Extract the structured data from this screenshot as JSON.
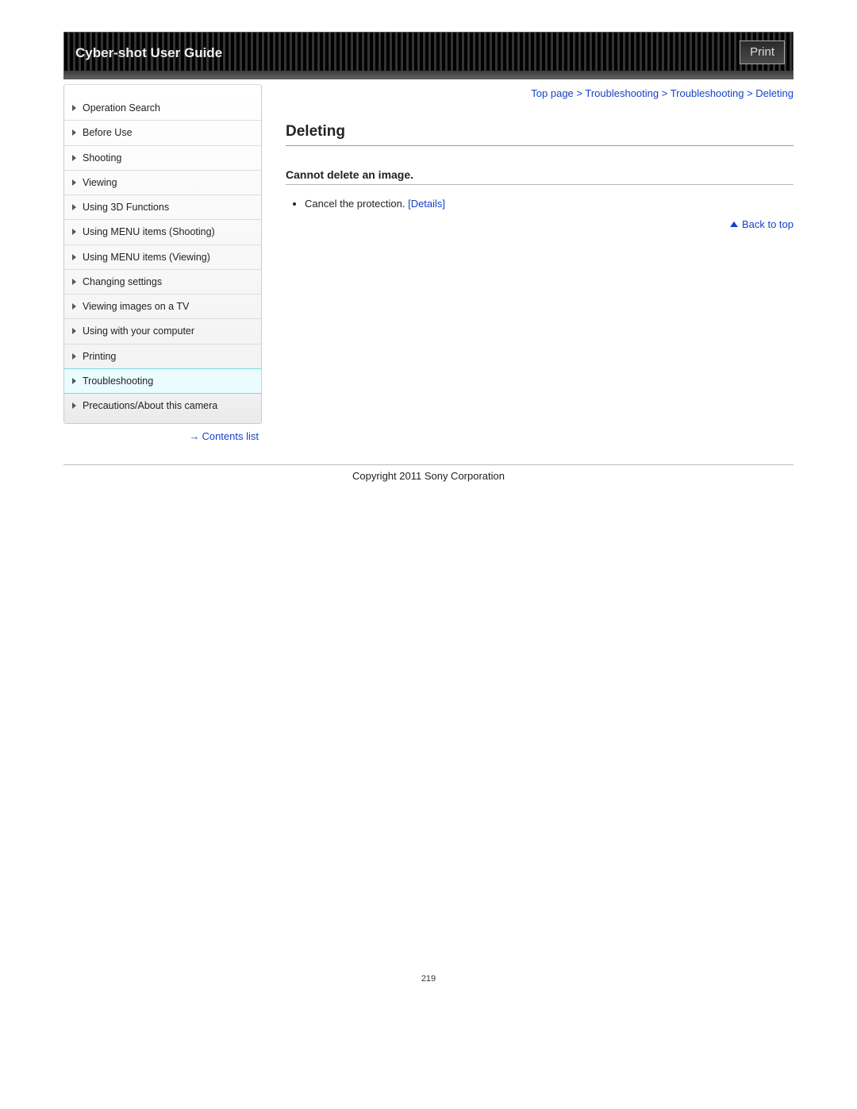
{
  "header": {
    "title": "Cyber-shot User Guide",
    "print_label": "Print"
  },
  "sidebar": {
    "items": [
      {
        "label": "Operation Search",
        "active": false
      },
      {
        "label": "Before Use",
        "active": false
      },
      {
        "label": "Shooting",
        "active": false
      },
      {
        "label": "Viewing",
        "active": false
      },
      {
        "label": "Using 3D Functions",
        "active": false
      },
      {
        "label": "Using MENU items (Shooting)",
        "active": false
      },
      {
        "label": "Using MENU items (Viewing)",
        "active": false
      },
      {
        "label": "Changing settings",
        "active": false
      },
      {
        "label": "Viewing images on a TV",
        "active": false
      },
      {
        "label": "Using with your computer",
        "active": false
      },
      {
        "label": "Printing",
        "active": false
      },
      {
        "label": "Troubleshooting",
        "active": true
      },
      {
        "label": "Precautions/About this camera",
        "active": false
      }
    ],
    "contents_link": "Contents list"
  },
  "breadcrumb": {
    "items": [
      "Top page",
      "Troubleshooting",
      "Troubleshooting",
      "Deleting"
    ],
    "sep": " > "
  },
  "main": {
    "title": "Deleting",
    "section_heading": "Cannot delete an image.",
    "bullet_text": "Cancel the protection. ",
    "details_label": "[Details]",
    "back_to_top": "Back to top"
  },
  "footer": {
    "copyright": "Copyright 2011 Sony Corporation",
    "page_number": "219"
  }
}
